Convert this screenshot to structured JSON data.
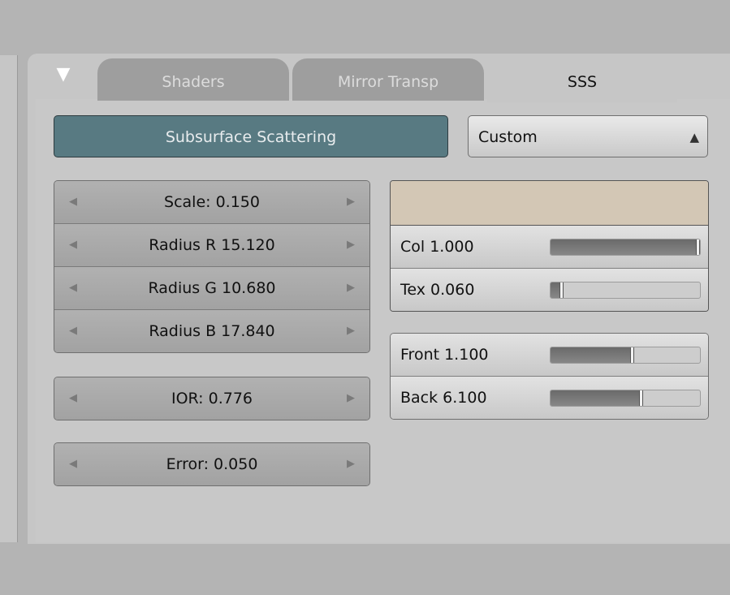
{
  "tabs": [
    {
      "label": "Shaders",
      "active": false
    },
    {
      "label": "Mirror Transp",
      "active": false
    },
    {
      "label": "SSS",
      "active": true
    }
  ],
  "sss": {
    "toggle_label": "Subsurface Scattering",
    "preset": "Custom",
    "scale": "Scale: 0.150",
    "radius_r": "Radius R 15.120",
    "radius_g": "Radius G 10.680",
    "radius_b": "Radius B 17.840",
    "ior": "IOR: 0.776",
    "error": "Error: 0.050",
    "color_hex": "#d3c7b5",
    "sliders": [
      {
        "label": "Col 1.000",
        "value": 1.0,
        "max": 1.0
      },
      {
        "label": "Tex 0.060",
        "value": 0.06,
        "max": 1.0
      },
      {
        "label": "Front 1.100",
        "value": 1.1,
        "max": 2.0
      },
      {
        "label": "Back 6.100",
        "value": 6.1,
        "max": 10.0
      }
    ]
  },
  "colors": {
    "toggle_active": "#587a82",
    "panel_bg": "#c6c6c6",
    "window_bg": "#b4b4b4"
  }
}
